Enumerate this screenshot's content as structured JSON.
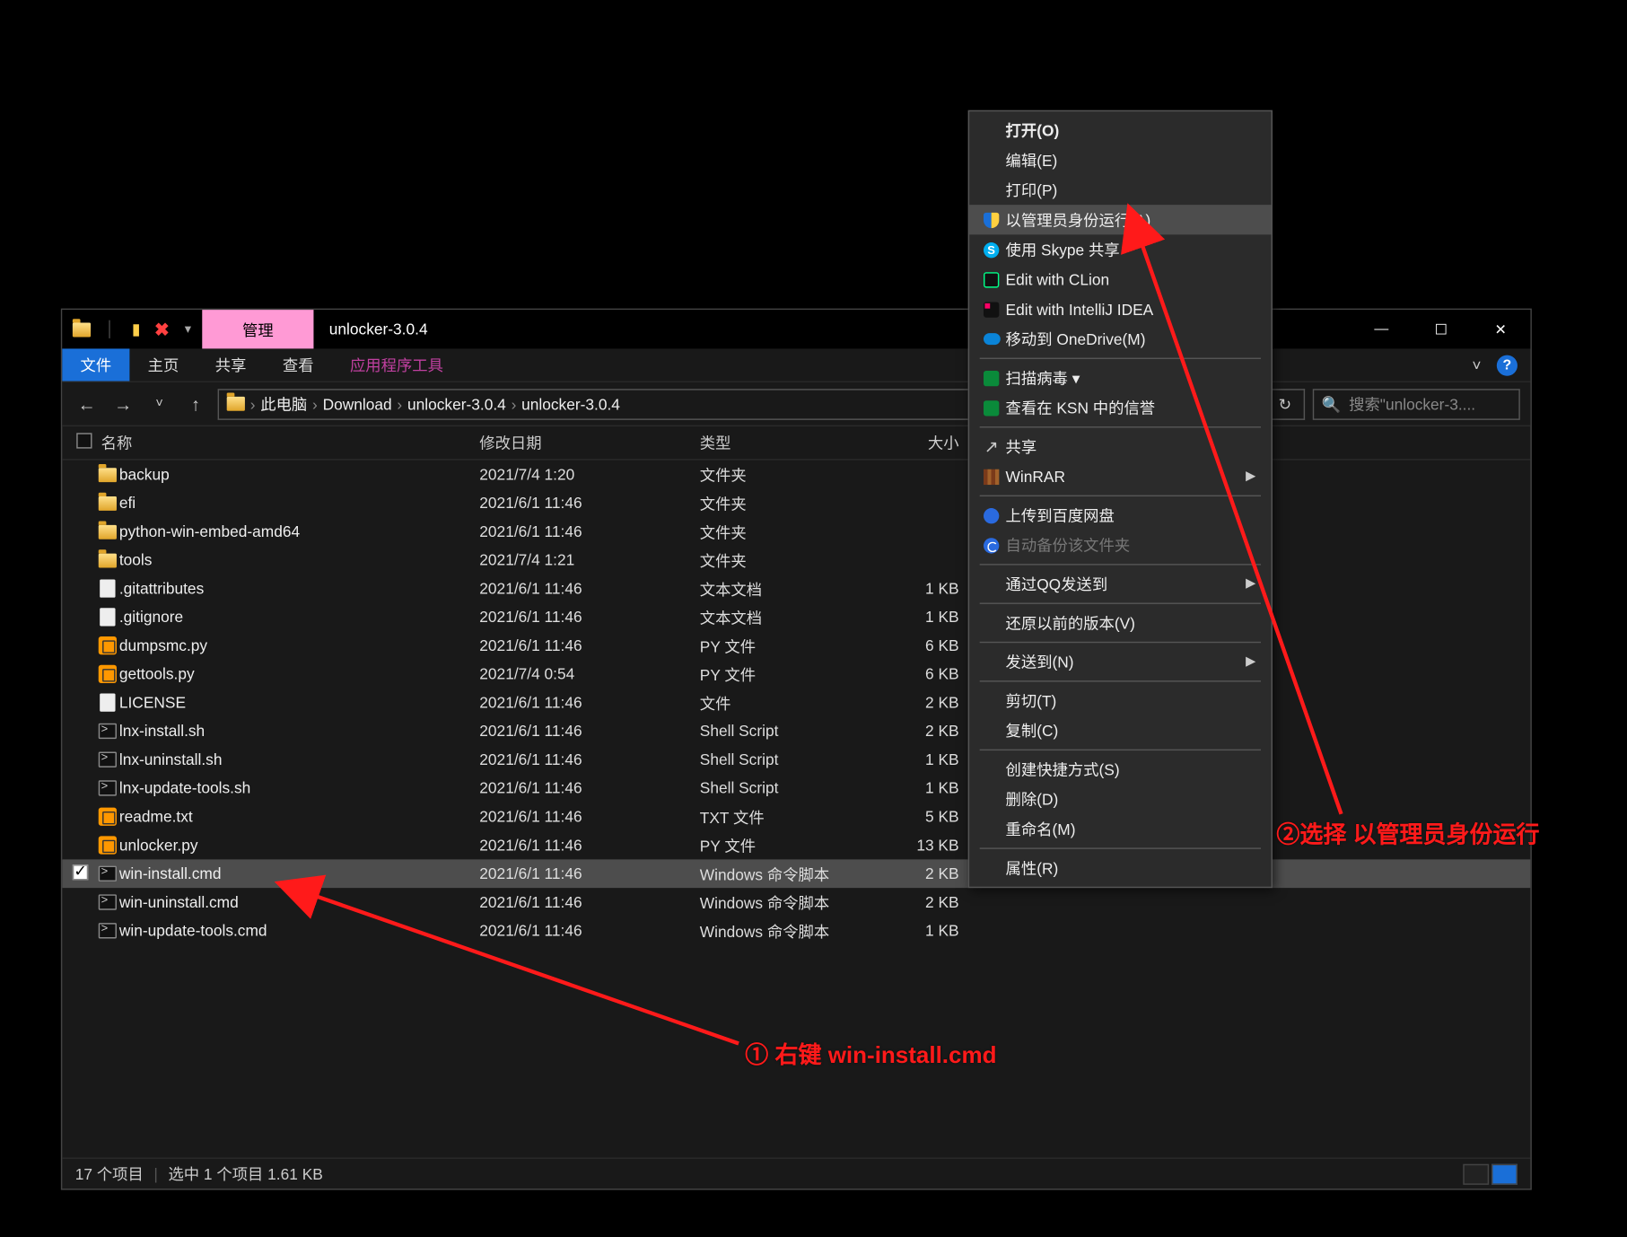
{
  "window": {
    "manage_tab": "管理",
    "title": "unlocker-3.0.4",
    "win_min": "—",
    "win_max": "☐",
    "win_close": "✕"
  },
  "ribbon": {
    "file": "文件",
    "home": "主页",
    "share": "共享",
    "view": "查看",
    "apptools": "应用程序工具",
    "caret": "˅",
    "help": "?"
  },
  "nav": {
    "back": "←",
    "forward": "→",
    "recent": "˅",
    "up": "↑",
    "refresh": "↻",
    "crumbs": [
      "此电脑",
      "Download",
      "unlocker-3.0.4",
      "unlocker-3.0.4"
    ],
    "search_icon": "🔍",
    "search_placeholder": "搜索\"unlocker-3...."
  },
  "columns": {
    "name": "名称",
    "modified": "修改日期",
    "type": "类型",
    "size": "大小"
  },
  "files": [
    {
      "icon": "folder",
      "name": "backup",
      "mod": "2021/7/4 1:20",
      "type": "文件夹",
      "size": ""
    },
    {
      "icon": "folder",
      "name": "efi",
      "mod": "2021/6/1 11:46",
      "type": "文件夹",
      "size": ""
    },
    {
      "icon": "folder",
      "name": "python-win-embed-amd64",
      "mod": "2021/6/1 11:46",
      "type": "文件夹",
      "size": ""
    },
    {
      "icon": "folder",
      "name": "tools",
      "mod": "2021/7/4 1:21",
      "type": "文件夹",
      "size": ""
    },
    {
      "icon": "file",
      "name": ".gitattributes",
      "mod": "2021/6/1 11:46",
      "type": "文本文档",
      "size": "1 KB"
    },
    {
      "icon": "file",
      "name": ".gitignore",
      "mod": "2021/6/1 11:46",
      "type": "文本文档",
      "size": "1 KB"
    },
    {
      "icon": "sub",
      "name": "dumpsmc.py",
      "mod": "2021/6/1 11:46",
      "type": "PY 文件",
      "size": "6 KB"
    },
    {
      "icon": "sub",
      "name": "gettools.py",
      "mod": "2021/7/4 0:54",
      "type": "PY 文件",
      "size": "6 KB"
    },
    {
      "icon": "file",
      "name": "LICENSE",
      "mod": "2021/6/1 11:46",
      "type": "文件",
      "size": "2 KB"
    },
    {
      "icon": "cmd",
      "name": "lnx-install.sh",
      "mod": "2021/6/1 11:46",
      "type": "Shell Script",
      "size": "2 KB"
    },
    {
      "icon": "cmd",
      "name": "lnx-uninstall.sh",
      "mod": "2021/6/1 11:46",
      "type": "Shell Script",
      "size": "1 KB"
    },
    {
      "icon": "cmd",
      "name": "lnx-update-tools.sh",
      "mod": "2021/6/1 11:46",
      "type": "Shell Script",
      "size": "1 KB"
    },
    {
      "icon": "sub",
      "name": "readme.txt",
      "mod": "2021/6/1 11:46",
      "type": "TXT 文件",
      "size": "5 KB"
    },
    {
      "icon": "sub",
      "name": "unlocker.py",
      "mod": "2021/6/1 11:46",
      "type": "PY 文件",
      "size": "13 KB"
    },
    {
      "icon": "cmd",
      "name": "win-install.cmd",
      "mod": "2021/6/1 11:46",
      "type": "Windows 命令脚本",
      "size": "2 KB",
      "selected": true,
      "checked": true
    },
    {
      "icon": "cmd",
      "name": "win-uninstall.cmd",
      "mod": "2021/6/1 11:46",
      "type": "Windows 命令脚本",
      "size": "2 KB"
    },
    {
      "icon": "cmd",
      "name": "win-update-tools.cmd",
      "mod": "2021/6/1 11:46",
      "type": "Windows 命令脚本",
      "size": "1 KB"
    }
  ],
  "status": {
    "items": "17 个项目",
    "selected": "选中 1 个项目  1.61 KB"
  },
  "context_menu": [
    {
      "kind": "item",
      "label": "打开(O)",
      "bold": true
    },
    {
      "kind": "item",
      "label": "编辑(E)"
    },
    {
      "kind": "item",
      "label": "打印(P)"
    },
    {
      "kind": "item",
      "label": "以管理员身份运行(A)",
      "icon": "shield",
      "hover": true
    },
    {
      "kind": "item",
      "label": "使用 Skype 共享",
      "icon": "skype"
    },
    {
      "kind": "item",
      "label": "Edit with CLion",
      "icon": "clion"
    },
    {
      "kind": "item",
      "label": "Edit with IntelliJ IDEA",
      "icon": "idea"
    },
    {
      "kind": "item",
      "label": "移动到 OneDrive(M)",
      "icon": "cloud"
    },
    {
      "kind": "sep"
    },
    {
      "kind": "item",
      "label": "扫描病毒 ▾",
      "icon": "green"
    },
    {
      "kind": "item",
      "label": "查看在 KSN 中的信誉",
      "icon": "green"
    },
    {
      "kind": "sep"
    },
    {
      "kind": "item",
      "label": "共享",
      "icon": "share"
    },
    {
      "kind": "item",
      "label": "WinRAR",
      "icon": "rar",
      "submenu": true
    },
    {
      "kind": "sep"
    },
    {
      "kind": "item",
      "label": "上传到百度网盘",
      "icon": "baidu"
    },
    {
      "kind": "item",
      "label": "自动备份该文件夹",
      "icon": "sync",
      "disabled": true
    },
    {
      "kind": "sep"
    },
    {
      "kind": "item",
      "label": "通过QQ发送到",
      "submenu": true
    },
    {
      "kind": "sep"
    },
    {
      "kind": "item",
      "label": "还原以前的版本(V)"
    },
    {
      "kind": "sep"
    },
    {
      "kind": "item",
      "label": "发送到(N)",
      "submenu": true
    },
    {
      "kind": "sep"
    },
    {
      "kind": "item",
      "label": "剪切(T)"
    },
    {
      "kind": "item",
      "label": "复制(C)"
    },
    {
      "kind": "sep"
    },
    {
      "kind": "item",
      "label": "创建快捷方式(S)"
    },
    {
      "kind": "item",
      "label": "删除(D)"
    },
    {
      "kind": "item",
      "label": "重命名(M)"
    },
    {
      "kind": "sep"
    },
    {
      "kind": "item",
      "label": "属性(R)"
    }
  ],
  "annotations": {
    "a1": "① 右键 win-install.cmd",
    "a2": "②选择 以管理员身份运行"
  }
}
